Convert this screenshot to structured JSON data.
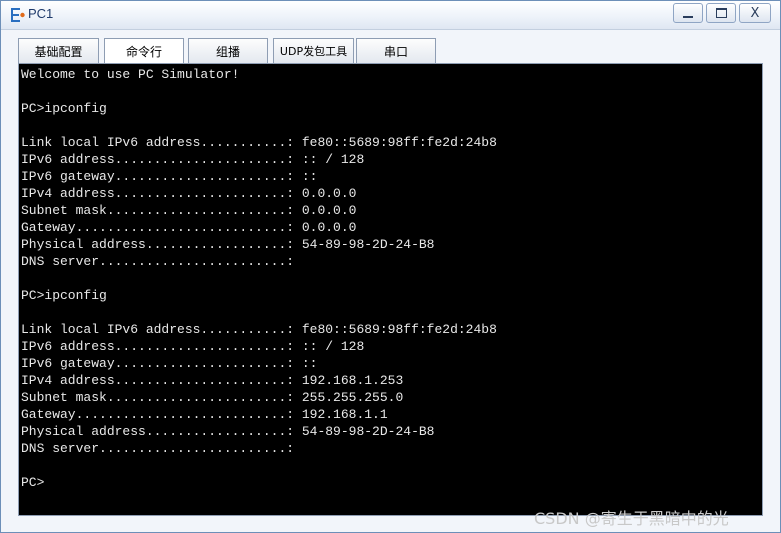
{
  "window": {
    "title": "PC1",
    "minimize": "",
    "maximize": "",
    "close": "X"
  },
  "tabs": [
    {
      "label": "基础配置",
      "active": false
    },
    {
      "label": "命令行",
      "active": true
    },
    {
      "label": "组播",
      "active": false
    },
    {
      "label": "UDP发包工具",
      "active": false
    },
    {
      "label": "串口",
      "active": false
    }
  ],
  "terminal": {
    "lines": [
      "Welcome to use PC Simulator!",
      "",
      "PC>ipconfig",
      "",
      "Link local IPv6 address...........: fe80::5689:98ff:fe2d:24b8",
      "IPv6 address......................: :: / 128",
      "IPv6 gateway......................: ::",
      "IPv4 address......................: 0.0.0.0",
      "Subnet mask.......................: 0.0.0.0",
      "Gateway...........................: 0.0.0.0",
      "Physical address..................: 54-89-98-2D-24-B8",
      "DNS server........................:",
      "",
      "PC>ipconfig",
      "",
      "Link local IPv6 address...........: fe80::5689:98ff:fe2d:24b8",
      "IPv6 address......................: :: / 128",
      "IPv6 gateway......................: ::",
      "IPv4 address......................: 192.168.1.253",
      "Subnet mask.......................: 255.255.255.0",
      "Gateway...........................: 192.168.1.1",
      "Physical address..................: 54-89-98-2D-24-B8",
      "DNS server........................:",
      "",
      "PC>"
    ]
  },
  "watermark": "CSDN @寄生于黑暗中的光"
}
